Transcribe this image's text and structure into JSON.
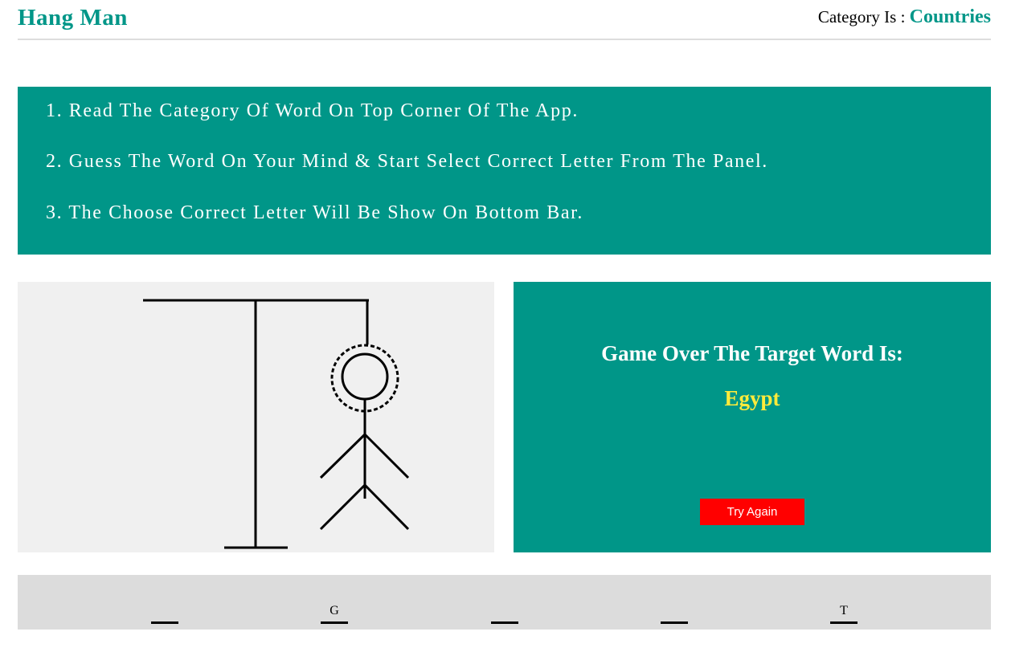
{
  "header": {
    "title": "Hang Man",
    "category_label": "Category Is :",
    "category_value": "Countries"
  },
  "instructions": [
    "1. Read The Category Of Word On Top Corner Of The App.",
    "2. Guess The Word On Your Mind & Start Select Correct Letter From The Panel.",
    "3. The Choose Correct Letter Will Be Show On Bottom Bar."
  ],
  "result": {
    "message": "Game Over The Target Word Is:",
    "word": "Egypt",
    "button_label": "Try Again"
  },
  "letters": [
    "",
    "G",
    "",
    "",
    "T"
  ],
  "colors": {
    "accent": "#009688",
    "word_highlight": "#ffeb3b",
    "button": "#ff0000",
    "stage_bg": "#f0f0f0",
    "letters_bar_bg": "#dcdcdc"
  }
}
